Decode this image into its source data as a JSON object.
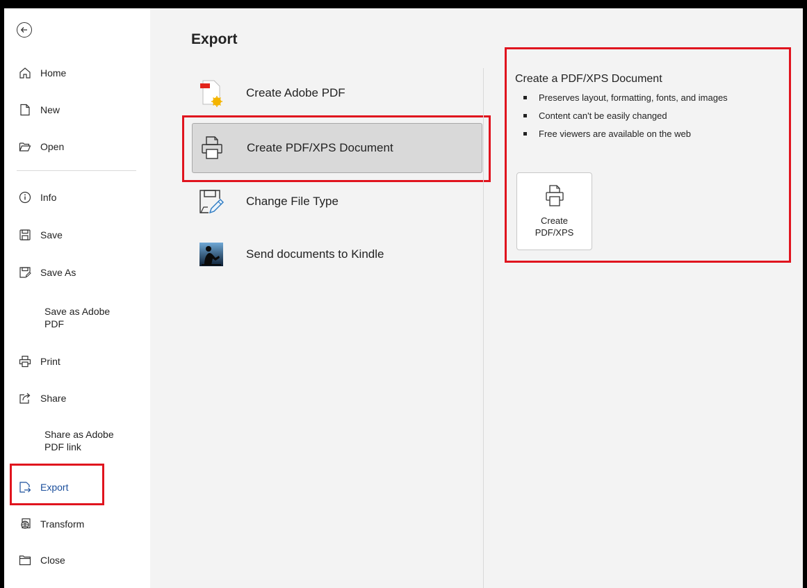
{
  "sidebar": {
    "back_icon": "back-arrow-icon",
    "items": [
      {
        "label": "Home",
        "icon": "home-icon"
      },
      {
        "label": "New",
        "icon": "new-document-icon"
      },
      {
        "label": "Open",
        "icon": "open-folder-icon"
      },
      {
        "label": "Info",
        "icon": "info-icon"
      },
      {
        "label": "Save",
        "icon": "save-icon"
      },
      {
        "label": "Save As",
        "icon": "save-as-icon"
      },
      {
        "label": "Save as Adobe PDF"
      },
      {
        "label": "Print",
        "icon": "print-icon"
      },
      {
        "label": "Share",
        "icon": "share-icon"
      },
      {
        "label": "Share as Adobe PDF link"
      },
      {
        "label": "Export",
        "icon": "export-icon"
      },
      {
        "label": "Transform",
        "icon": "transform-icon"
      },
      {
        "label": "Close",
        "icon": "close-folder-icon"
      }
    ]
  },
  "main": {
    "title": "Export",
    "options": [
      {
        "label": "Create Adobe PDF",
        "icon": "adobe-pdf-icon"
      },
      {
        "label": "Create PDF/XPS Document",
        "icon": "pdf-xps-icon",
        "selected": true
      },
      {
        "label": "Change File Type",
        "icon": "change-file-type-icon"
      },
      {
        "label": "Send documents to Kindle",
        "icon": "kindle-icon"
      }
    ]
  },
  "detail": {
    "title": "Create a PDF/XPS Document",
    "bullets": [
      "Preserves layout, formatting, fonts, and images",
      "Content can't be easily changed",
      "Free viewers are available on the web"
    ],
    "button_label": "Create\nPDF/XPS"
  },
  "colors": {
    "highlight_box": "#e0141e",
    "active_nav": "#1b4f9c",
    "selected_option_bg": "#d9d9d9"
  }
}
